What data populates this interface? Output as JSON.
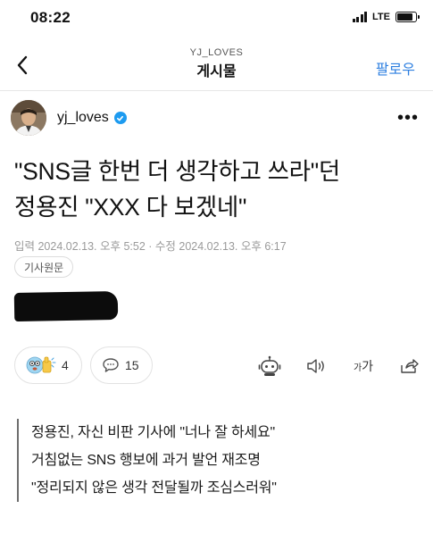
{
  "status_bar": {
    "time": "08:22",
    "network": "LTE",
    "battery_level": 0.85
  },
  "nav": {
    "back_icon": "chevron-left-icon",
    "subtitle": "YJ_LOVES",
    "title": "게시물",
    "follow_label": "팔로우",
    "accent_color": "#2d7fe0"
  },
  "profile": {
    "username": "yj_loves",
    "verified_icon": "verified-badge-icon",
    "more_icon": "more-horizontal-icon",
    "more_label": "•••"
  },
  "article": {
    "headline_line1": "\"SNS글 한번 더 생각하고 쓰라\"던",
    "headline_line2": "정용진 \"XXX 다 보겠네\"",
    "dateline": "입력 2024.02.13. 오후 5:52 · 수정 2024.02.13. 오후 6:17",
    "source_label": "기사원문"
  },
  "actions": {
    "reaction_icon": "emoji-reaction-icon",
    "reaction_count": "4",
    "comment_icon": "comment-bubble-icon",
    "comment_count": "15",
    "tools": [
      "robot-summary-icon",
      "speaker-icon",
      "font-size-icon",
      "share-icon"
    ],
    "font_size_label_small": "가",
    "font_size_label_large": "가"
  },
  "summary": {
    "lines": [
      "정용진, 자신 비판 기사에 \"너나 잘 하세요\"",
      "거침없는 SNS 행보에 과거 발언 재조명",
      "\"정리되지 않은 생각 전달될까 조심스러워\""
    ]
  }
}
